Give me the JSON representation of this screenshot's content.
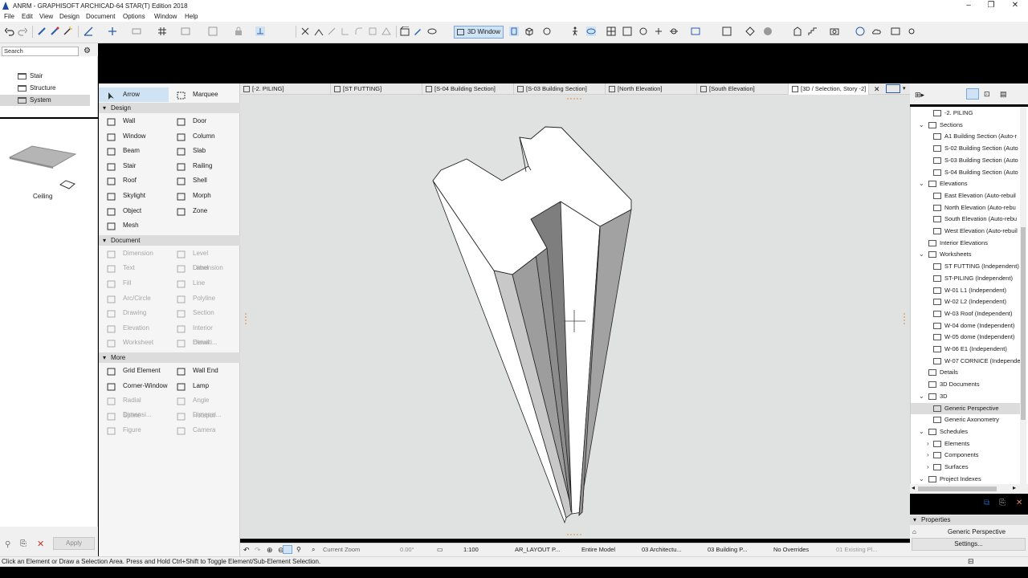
{
  "window": {
    "title": "ANRM - GRAPHISOFT ARCHICAD-64 STAR(T) Edition 2018"
  },
  "menu": [
    "File",
    "Edit",
    "View",
    "Design",
    "Document",
    "Options",
    "Window",
    "Help"
  ],
  "toolbar": {
    "view3d_label": "3D Window"
  },
  "navigator": {
    "search_placeholder": "Search",
    "items": [
      {
        "label": "Stair",
        "selected": false
      },
      {
        "label": "Structure",
        "selected": false
      },
      {
        "label": "System",
        "selected": true
      }
    ],
    "preview_label": "Ceiling"
  },
  "toolbox": {
    "top": [
      {
        "label": "Arrow",
        "selected": true
      },
      {
        "label": "Marquee"
      }
    ],
    "sections": [
      {
        "title": "Design",
        "tools": [
          [
            "Wall",
            "Door"
          ],
          [
            "Window",
            "Column"
          ],
          [
            "Beam",
            "Slab"
          ],
          [
            "Stair",
            "Railing"
          ],
          [
            "Roof",
            "Shell"
          ],
          [
            "Skylight",
            "Morph"
          ],
          [
            "Object",
            "Zone"
          ],
          [
            "Mesh",
            ""
          ]
        ],
        "disabled": false
      },
      {
        "title": "Document",
        "tools": [
          [
            "Dimension",
            "Level Dimension"
          ],
          [
            "Text",
            "Label"
          ],
          [
            "Fill",
            "Line"
          ],
          [
            "Arc/Circle",
            "Polyline"
          ],
          [
            "Drawing",
            "Section"
          ],
          [
            "Elevation",
            "Interior Elevati..."
          ],
          [
            "Worksheet",
            "Detail"
          ]
        ],
        "disabled": true
      },
      {
        "title": "More",
        "tools": [
          [
            "Grid Element",
            "Wall End"
          ],
          [
            "Corner-Window",
            "Lamp"
          ],
          [
            "Radial Dimensi...",
            "Angle Dimensi..."
          ],
          [
            "Spline",
            "Hotspot"
          ],
          [
            "Figure",
            "Camera"
          ]
        ],
        "disabled_from": 2
      }
    ]
  },
  "tabs": [
    {
      "label": "[-2. PILING]"
    },
    {
      "label": "[ST FUTTING]"
    },
    {
      "label": "[S-04 Building Section]"
    },
    {
      "label": "[S-03 Building Section]"
    },
    {
      "label": "[North Elevation]"
    },
    {
      "label": "[South Elevation]"
    },
    {
      "label": "[3D / Selection, Story -2]",
      "active": true
    }
  ],
  "viewbar": {
    "zoom_label": "Current Zoom",
    "angle": "0.00°",
    "scale": "1:100",
    "layer_combo": "AR_LAYOUT P...",
    "model_view": "Entire Model",
    "pen_set": "03 Architectu...",
    "mvo": "03 Building P...",
    "overrides": "No Overrides",
    "renovation": "01 Existing Pl..."
  },
  "project_tree": [
    {
      "label": "-2. PILING",
      "level": 3
    },
    {
      "label": "Sections",
      "level": 1,
      "expanded": true
    },
    {
      "label": "A1 Building Section (Auto-r",
      "level": 2
    },
    {
      "label": "S-02 Building Section (Auto",
      "level": 2
    },
    {
      "label": "S-03 Building Section (Auto",
      "level": 2
    },
    {
      "label": "S-04 Building Section (Auto",
      "level": 2
    },
    {
      "label": "Elevations",
      "level": 1,
      "expanded": true
    },
    {
      "label": "East Elevation (Auto-rebuil",
      "level": 2
    },
    {
      "label": "North Elevation (Auto-rebu",
      "level": 2
    },
    {
      "label": "South Elevation (Auto-rebu",
      "level": 2
    },
    {
      "label": "West Elevation (Auto-rebuil",
      "level": 2
    },
    {
      "label": "Interior Elevations",
      "level": 1
    },
    {
      "label": "Worksheets",
      "level": 1,
      "expanded": true
    },
    {
      "label": "ST FUTTING (Independent)",
      "level": 2
    },
    {
      "label": "ST-PILING (Independent)",
      "level": 2
    },
    {
      "label": "W-01 L1 (Independent)",
      "level": 2
    },
    {
      "label": "W-02 L2 (Independent)",
      "level": 2
    },
    {
      "label": "W-03 Roof (Independent)",
      "level": 2
    },
    {
      "label": "W-04 dome (Independent)",
      "level": 2
    },
    {
      "label": "W-05 dome (Independent)",
      "level": 2
    },
    {
      "label": "W-06 E1 (Independent)",
      "level": 2
    },
    {
      "label": "W-07 CORNICE  (Independe",
      "level": 2
    },
    {
      "label": "Details",
      "level": 1
    },
    {
      "label": "3D Documents",
      "level": 1
    },
    {
      "label": "3D",
      "level": 1,
      "expanded": true
    },
    {
      "label": "Generic Perspective",
      "level": 2,
      "selected": true
    },
    {
      "label": "Generic Axonometry",
      "level": 2
    },
    {
      "label": "Schedules",
      "level": 1,
      "expanded": true
    },
    {
      "label": "Elements",
      "level": 2,
      "collapsed": true
    },
    {
      "label": "Components",
      "level": 2,
      "collapsed": true
    },
    {
      "label": "Surfaces",
      "level": 2,
      "collapsed": true
    },
    {
      "label": "Project Indexes",
      "level": 1,
      "expanded": true
    }
  ],
  "properties": {
    "header": "Properties",
    "name": "Generic Perspective",
    "settings_label": "Settings..."
  },
  "bottom_left": {
    "apply_label": "Apply"
  },
  "status": "Click an Element or Draw a Selection Area. Press and Hold Ctrl+Shift to Toggle Element/Sub-Element Selection."
}
